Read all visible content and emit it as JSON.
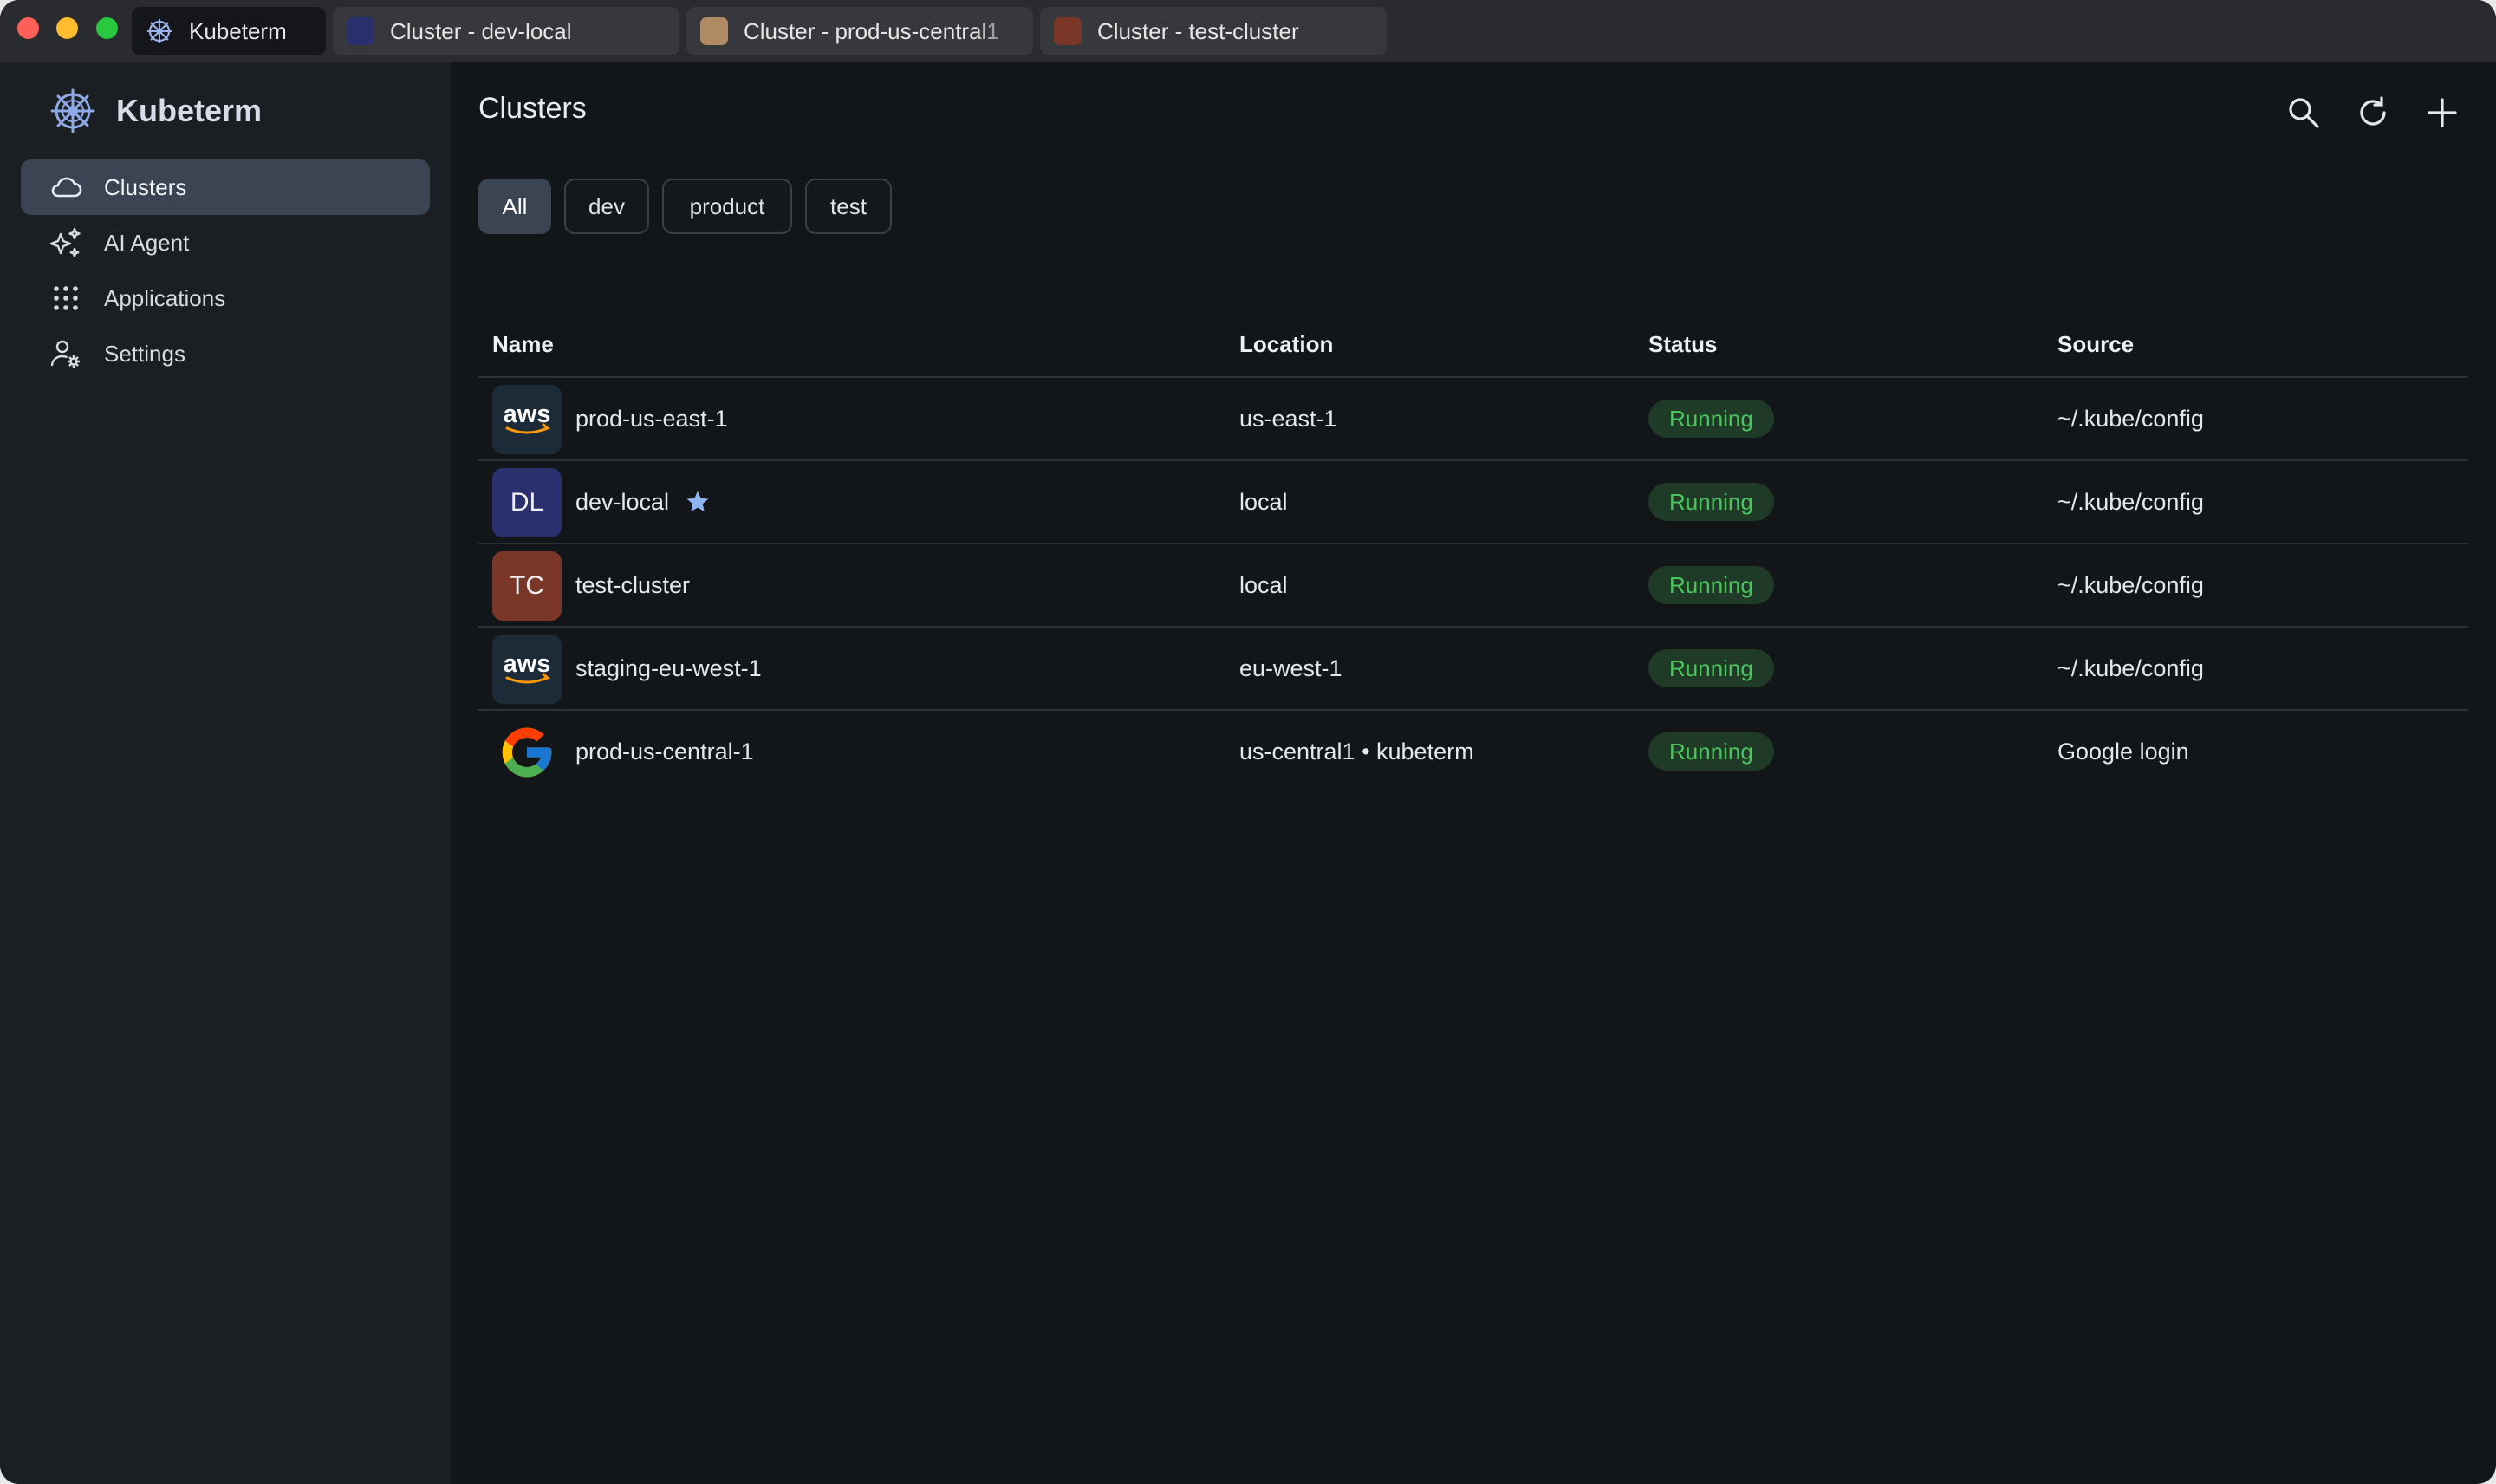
{
  "tabs": [
    {
      "label": "Kubeterm",
      "active": true,
      "swatch": "logo"
    },
    {
      "label": "Cluster - dev-local",
      "active": false,
      "swatch": "#2a2f6e"
    },
    {
      "label": "Cluster - prod-us-central1",
      "active": false,
      "swatch": "#b08a63"
    },
    {
      "label": "Cluster - test-cluster",
      "active": false,
      "swatch": "#7a3626"
    }
  ],
  "sidebar": {
    "brand": "Kubeterm",
    "items": [
      {
        "label": "Clusters",
        "icon": "cloud-icon",
        "active": true
      },
      {
        "label": "AI Agent",
        "icon": "sparkles-icon",
        "active": false
      },
      {
        "label": "Applications",
        "icon": "grid-icon",
        "active": false
      },
      {
        "label": "Settings",
        "icon": "user-settings-icon",
        "active": false
      }
    ]
  },
  "main": {
    "title": "Clusters",
    "toolbar": [
      "search-icon",
      "refresh-icon",
      "plus-icon"
    ],
    "filters": [
      {
        "label": "All",
        "active": true
      },
      {
        "label": "dev",
        "active": false
      },
      {
        "label": "product",
        "active": false
      },
      {
        "label": "test",
        "active": false
      }
    ],
    "columns": [
      "Name",
      "Location",
      "Status",
      "Source"
    ],
    "rows": [
      {
        "name": "prod-us-east-1",
        "avatar": "aws",
        "location": "us-east-1",
        "status": "Running",
        "source": "~/.kube/config",
        "starred": false
      },
      {
        "name": "dev-local",
        "avatar": "DL",
        "avatar_color": "#2a2f6e",
        "location": "local",
        "status": "Running",
        "source": "~/.kube/config",
        "starred": true
      },
      {
        "name": "test-cluster",
        "avatar": "TC",
        "avatar_color": "#7a3626",
        "location": "local",
        "status": "Running",
        "source": "~/.kube/config",
        "starred": false
      },
      {
        "name": "staging-eu-west-1",
        "avatar": "aws",
        "location": "eu-west-1",
        "status": "Running",
        "source": "~/.kube/config",
        "starred": false
      },
      {
        "name": "prod-us-central-1",
        "avatar": "google",
        "location": "us-central1 • kubeterm",
        "status": "Running",
        "source": "Google login",
        "starred": false
      }
    ]
  },
  "colors": {
    "accent": "#3a4452",
    "status_running": "#4cc45e",
    "star": "#8fb4f2"
  }
}
